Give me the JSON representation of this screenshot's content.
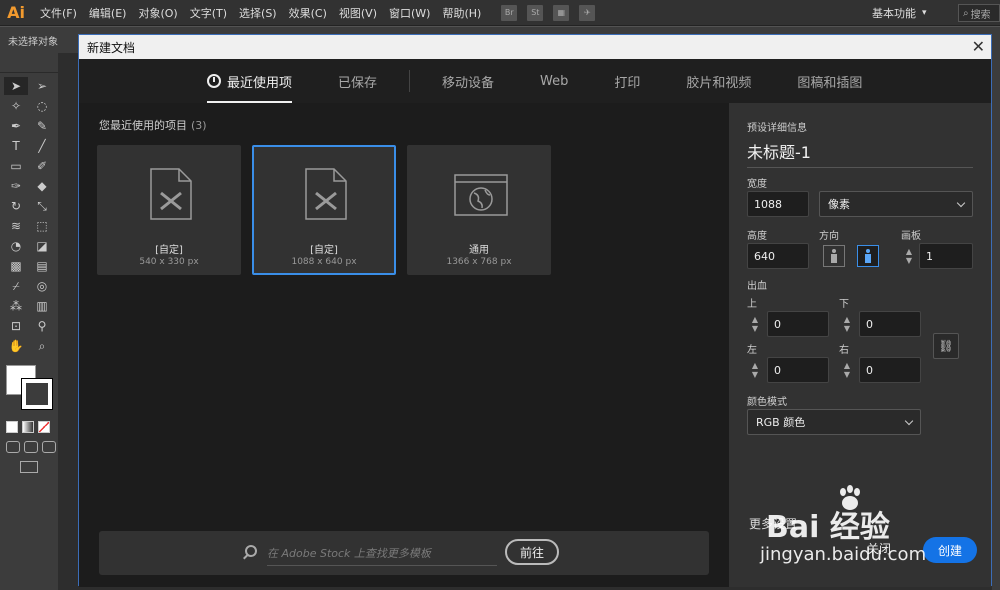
{
  "app": {
    "logo": "Ai"
  },
  "menubar": {
    "items": [
      "文件(F)",
      "编辑(E)",
      "对象(O)",
      "文字(T)",
      "选择(S)",
      "效果(C)",
      "视图(V)",
      "窗口(W)",
      "帮助(H)"
    ],
    "app_icons": [
      "Br",
      "St"
    ],
    "workspace": "基本功能",
    "search": "搜索"
  },
  "control_bar": {
    "status": "未选择对象"
  },
  "dialog": {
    "title": "新建文档",
    "tabs": [
      {
        "label": "最近使用项",
        "active": true
      },
      {
        "label": "已保存"
      },
      {
        "label": "移动设备"
      },
      {
        "label": "Web"
      },
      {
        "label": "打印"
      },
      {
        "label": "胶片和视频"
      },
      {
        "label": "图稿和插图"
      }
    ],
    "recent": {
      "heading": "您最近使用的项目",
      "count": "(3)",
      "items": [
        {
          "name": "[自定]",
          "size": "540 x 330 px",
          "icon": "custom-document-icon",
          "selected": false
        },
        {
          "name": "[自定]",
          "size": "1088 x 640 px",
          "icon": "custom-document-icon",
          "selected": true
        },
        {
          "name": "通用",
          "size": "1366 x 768 px",
          "icon": "web-globe-icon",
          "selected": false
        }
      ]
    },
    "stock": {
      "placeholder": "在 Adobe Stock 上查找更多模板",
      "go_label": "前往"
    },
    "details": {
      "heading": "预设详细信息",
      "preset_name": "未标题-1",
      "width_label": "宽度",
      "width": "1088",
      "unit": "像素",
      "height_label": "高度",
      "height": "640",
      "orientation_label": "方向",
      "artboards_label": "画板",
      "artboards": "1",
      "bleed_label": "出血",
      "bleed_top_label": "上",
      "bleed_top": "0",
      "bleed_bottom_label": "下",
      "bleed_bottom": "0",
      "bleed_left_label": "左",
      "bleed_left": "0",
      "bleed_right_label": "右",
      "bleed_right": "0",
      "color_mode_label": "颜色模式",
      "color_mode": "RGB 颜色",
      "more_settings": "更多设置",
      "close_label": "关闭",
      "create_label": "创建"
    }
  },
  "watermark": {
    "brand": "Bai 经验",
    "url": "jingyan.baidu.com"
  },
  "colors": {
    "accent": "#1473e6",
    "selection": "#3a8ee8",
    "logo": "#f29a2e"
  }
}
